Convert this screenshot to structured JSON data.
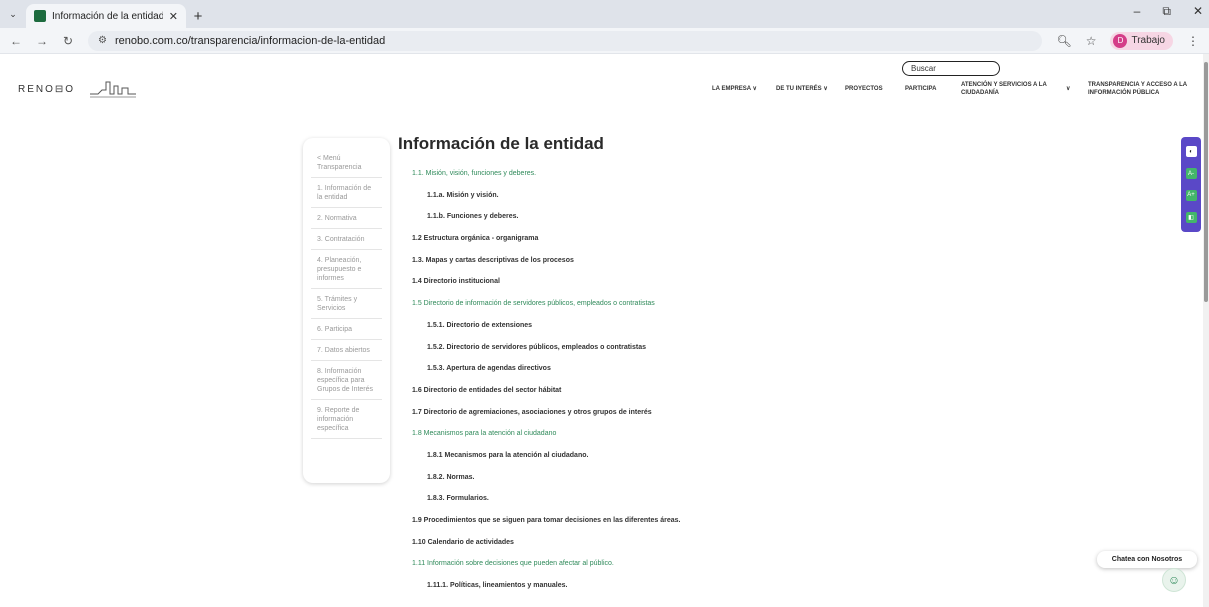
{
  "browser": {
    "tab_title": "Información de la entidad | Ren",
    "url": "renobo.com.co/transparencia/informacion-de-la-entidad",
    "profile_name": "Trabajo",
    "profile_initial": "D",
    "new_tab_icon": "+",
    "close_icon": "✕"
  },
  "header": {
    "logo_text": "RENO⊟O",
    "search_placeholder": "Buscar",
    "nav": [
      {
        "label": "LA EMPRESA ∨"
      },
      {
        "label": "DE TU INTERÉS ∨"
      },
      {
        "label": "PROYECTOS"
      },
      {
        "label": "PARTICIPA"
      },
      {
        "label": "ATENCIÓN Y SERVICIOS A LA CIUDADANÍA"
      },
      {
        "label": "∨"
      },
      {
        "label": "TRANSPARENCIA Y ACCESO A LA INFORMACIÓN PÚBLICA"
      }
    ]
  },
  "accessibility": {
    "buttons": [
      "◐",
      "A-",
      "A+",
      "◧"
    ]
  },
  "sidemenu": {
    "items": [
      "< Menú Transparencia",
      "1. Información de la entidad",
      "2. Normativa",
      "3. Contratación",
      "4. Planeación, presupuesto e informes",
      "5. Trámites y Servicios",
      "6. Participa",
      "7. Datos abiertos",
      "8. Información específica para Grupos de Interés",
      "9. Reporte de información específica"
    ]
  },
  "main": {
    "title": "Información de la entidad",
    "toc": [
      {
        "text": "1.1. Misión, visión, funciones y deberes.",
        "level": 1,
        "link": true,
        "bold": false
      },
      {
        "text": "1.1.a. Misión y visión.",
        "level": 2,
        "link": false,
        "bold": true
      },
      {
        "text": "1.1.b. Funciones y deberes.",
        "level": 2,
        "link": false,
        "bold": true
      },
      {
        "text": "1.2 Estructura orgánica - organigrama",
        "level": 1,
        "link": false,
        "bold": true
      },
      {
        "text": "1.3. Mapas y cartas descriptivas de los procesos",
        "level": 1,
        "link": false,
        "bold": true
      },
      {
        "text": "1.4 Directorio institucional",
        "level": 1,
        "link": false,
        "bold": true
      },
      {
        "text": "1.5 Directorio de información de servidores públicos, empleados o contratistas",
        "level": 1,
        "link": true,
        "bold": false
      },
      {
        "text": "1.5.1. Directorio de extensiones",
        "level": 2,
        "link": false,
        "bold": true
      },
      {
        "text": "1.5.2. Directorio de servidores públicos, empleados o contratistas",
        "level": 2,
        "link": false,
        "bold": true
      },
      {
        "text": "1.5.3. Apertura de agendas directivos",
        "level": 2,
        "link": false,
        "bold": true
      },
      {
        "text": "1.6 Directorio de entidades del sector hábitat",
        "level": 1,
        "link": false,
        "bold": true
      },
      {
        "text": "1.7 Directorio de agremiaciones, asociaciones y otros grupos de interés",
        "level": 1,
        "link": false,
        "bold": true
      },
      {
        "text": "1.8 Mecanismos para la atención al ciudadano",
        "level": 1,
        "link": true,
        "bold": false
      },
      {
        "text": "1.8.1 Mecanismos para la atención al ciudadano.",
        "level": 2,
        "link": false,
        "bold": true
      },
      {
        "text": "1.8.2. Normas.",
        "level": 2,
        "link": false,
        "bold": true
      },
      {
        "text": "1.8.3. Formularios.",
        "level": 2,
        "link": false,
        "bold": true
      },
      {
        "text": "1.9 Procedimientos que se siguen para tomar decisiones en las diferentes áreas.",
        "level": 1,
        "link": false,
        "bold": true
      },
      {
        "text": "1.10 Calendario de actividades",
        "level": 1,
        "link": false,
        "bold": true
      },
      {
        "text": "1.11 Información sobre decisiones que pueden afectar al público.",
        "level": 1,
        "link": true,
        "bold": false
      },
      {
        "text": "1.11.1. Políticas, lineamientos y manuales.",
        "level": 2,
        "link": false,
        "bold": true
      }
    ]
  },
  "chat": {
    "label": "Chatea con Nosotros"
  },
  "colors": {
    "link_green": "#2f8a5a",
    "a11y_purple": "#5a48c7"
  }
}
